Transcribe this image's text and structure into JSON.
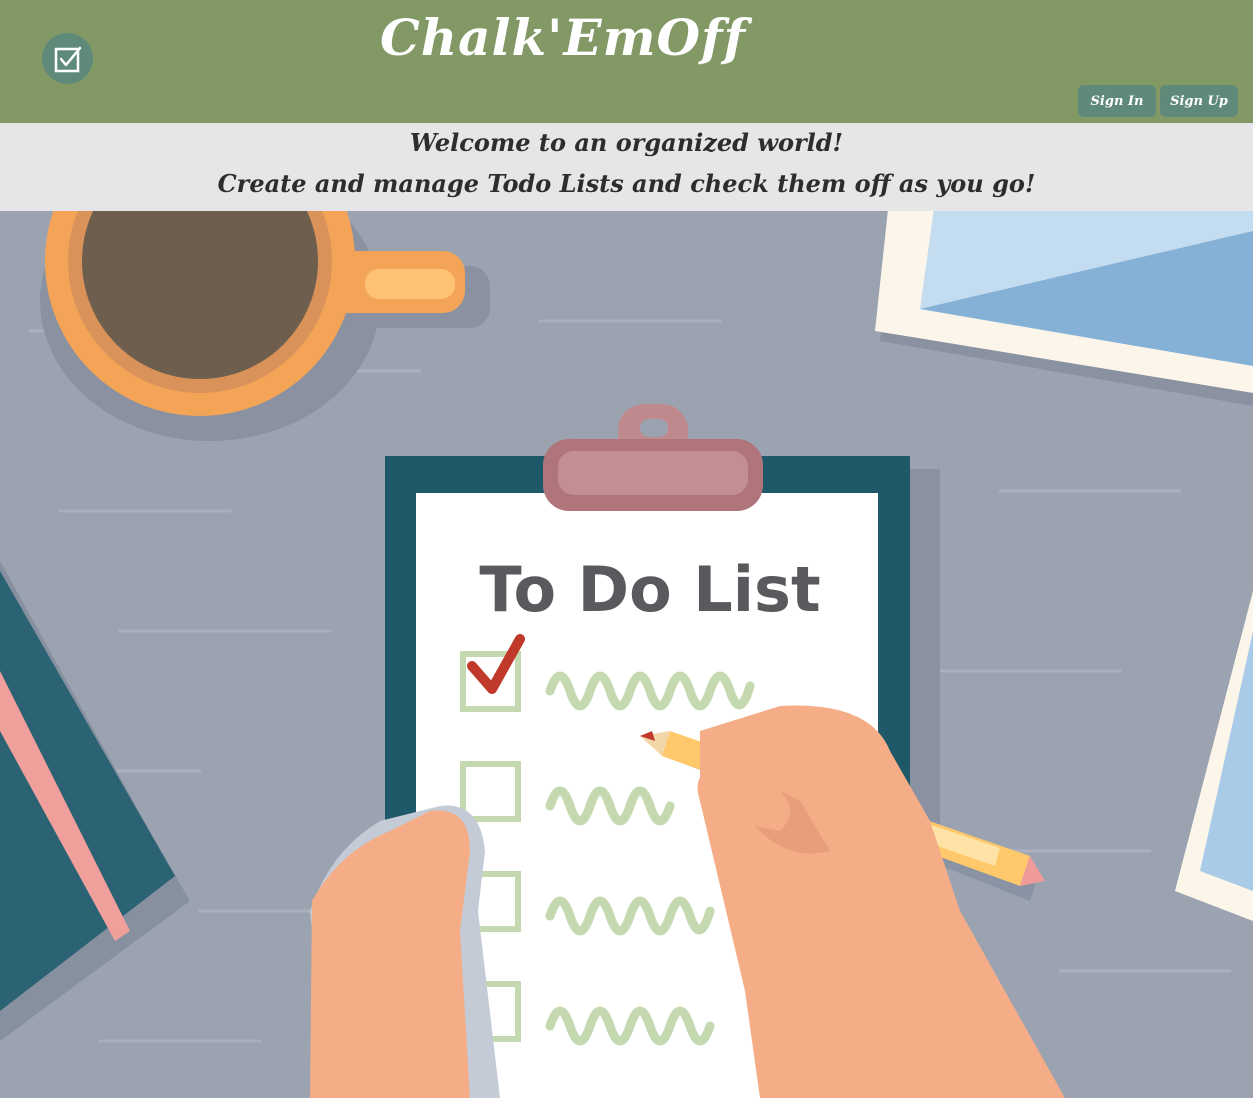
{
  "header": {
    "brand": "Chalk'EmOff",
    "logo_icon": "checkbox-checked-icon",
    "sign_in_label": "Sign In",
    "sign_up_label": "Sign Up"
  },
  "banner": {
    "welcome": "Welcome to an organized world!",
    "subtitle": "Create and manage Todo Lists and check them off as you go!"
  },
  "hero": {
    "clipboard_title": "To Do List",
    "items_checked": [
      true,
      false,
      false,
      false
    ]
  },
  "colors": {
    "header_bg": "#829966",
    "button_bg": "#5f8a7a",
    "banner_bg": "#e6e6e8",
    "desk": "#9ba3b1",
    "clipboard": "#1f5868",
    "check_red": "#c0392b"
  }
}
